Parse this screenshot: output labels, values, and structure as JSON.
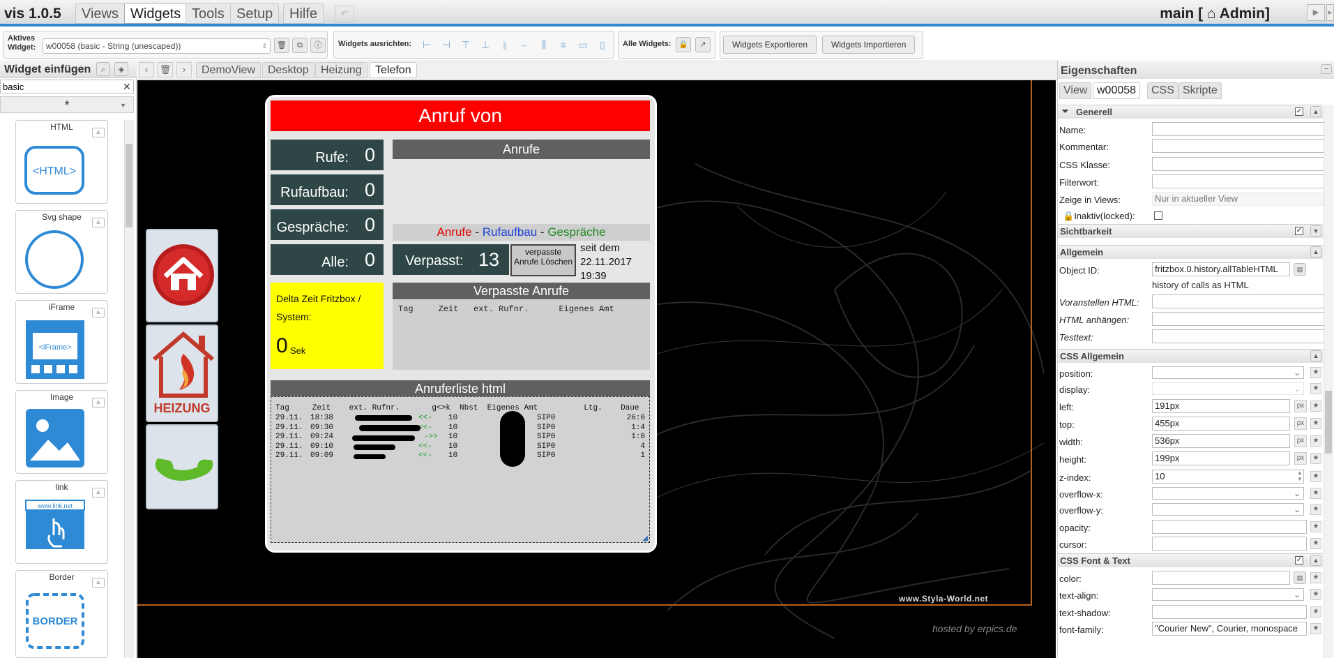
{
  "app": {
    "title": "vis 1.0.5",
    "menu": [
      "Views",
      "Widgets",
      "Tools",
      "Setup",
      "Hilfe"
    ],
    "active_menu": "Widgets",
    "main_title": "main [ ⌂ Admin]"
  },
  "toolbar": {
    "active_widget_label": "Aktives Widget:",
    "active_widget_value": "w00058 (basic - String (unescaped))",
    "align_label": "Widgets ausrichten:",
    "all_widgets_label": "Alle Widgets:",
    "export_label": "Widgets Exportieren",
    "import_label": "Widgets Importieren"
  },
  "left_panel": {
    "title": "Widget einfügen",
    "filter_value": "basic",
    "set_value": "*",
    "widgets": [
      "HTML",
      "Svg shape",
      "iFrame",
      "Image",
      "link",
      "Border"
    ]
  },
  "views": {
    "tabs": [
      "DemoView",
      "Desktop",
      "Heizung",
      "Telefon"
    ],
    "active": "Telefon"
  },
  "canvas": {
    "watermark": "www.Styla-World.net",
    "hosted": "hosted by erpics.de"
  },
  "phone": {
    "header": "Anruf von",
    "stats": [
      {
        "label": "Rufe:",
        "value": "0"
      },
      {
        "label": "Rufaufbau:",
        "value": "0"
      },
      {
        "label": "Gespräche:",
        "value": "0"
      },
      {
        "label": "Alle:",
        "value": "0"
      }
    ],
    "anrufe_header": "Anrufe",
    "legend": {
      "a": "Anrufe",
      "b": "Rufaufbau",
      "c": "Gespräche",
      "sep": "-"
    },
    "missed_label": "Verpasst:",
    "missed_value": "13",
    "delete_button": "verpasste Anrufe Löschen",
    "since_label": "seit dem",
    "since_date": "22.11.2017",
    "since_time": "19:39",
    "delta_label": "Delta Zeit Fritzbox / System:",
    "delta_value": "0",
    "delta_unit": "Sek",
    "missed_header": "Verpasste Anrufe",
    "missed_columns": "Tag     Zeit   ext. Rufnr.      Eigenes Amt",
    "list_header": "Anruferliste html",
    "list_columns": "Tag     Zeit    ext. Rufnr.       g<>k  Nbst  Eigenes Amt          Ltg.    Daue",
    "rows": [
      {
        "tag": "29.11.",
        "zeit": "18:38",
        "dir": "<<-",
        "nbst": "10",
        "ltg": "SIP0",
        "dauer": "26:0"
      },
      {
        "tag": "29.11.",
        "zeit": "09:30",
        "dir": "<<-",
        "nbst": "10",
        "ltg": "SIP0",
        "dauer": "1:4"
      },
      {
        "tag": "29.11.",
        "zeit": "09:24",
        "dir": "->>",
        "nbst": "10",
        "ltg": "SIP0",
        "dauer": "1:0"
      },
      {
        "tag": "29.11.",
        "zeit": "09:10",
        "dir": "<<-",
        "nbst": "10",
        "ltg": "SIP0",
        "dauer": "4"
      },
      {
        "tag": "29.11.",
        "zeit": "09:09",
        "dir": "<<-",
        "nbst": "10",
        "ltg": "SIP0",
        "dauer": "1"
      }
    ],
    "heizung_label": "HEIZUNG"
  },
  "right_panel": {
    "title": "Eigenschaften",
    "tabs": [
      "View",
      "w00058",
      "CSS",
      "Skripte"
    ],
    "active_tab": "w00058",
    "sections": {
      "generell": "Generell",
      "sichtbarkeit": "Sichtbarkeit",
      "allgemein": "Allgemein",
      "css_allgemein": "CSS Allgemein",
      "css_font": "CSS Font & Text"
    },
    "generell": {
      "name": "Name:",
      "kommentar": "Kommentar:",
      "css_klasse": "CSS Klasse:",
      "filterwort": "Filterwort:",
      "zeige": "Zeige in Views:",
      "zeige_value": "Nur in aktueller View",
      "inaktiv": "Inaktiv(locked):"
    },
    "allgemein": {
      "object_id": "Object ID:",
      "object_id_value": "fritzbox.0.history.allTableHTML",
      "object_desc": "history of calls as HTML",
      "voranstellen": "Voranstellen HTML:",
      "anhaengen": "HTML anhängen:",
      "testtext": "Testtext:"
    },
    "css": {
      "position": "position:",
      "display": "display:",
      "left": "left:",
      "left_value": "191px",
      "top": "top:",
      "top_value": "455px",
      "width": "width:",
      "width_value": "536px",
      "height": "height:",
      "height_value": "199px",
      "zindex": "z-index:",
      "zindex_value": "10",
      "overflowx": "overflow-x:",
      "overflowy": "overflow-y:",
      "opacity": "opacity:",
      "cursor": "cursor:",
      "unit": "px"
    },
    "font": {
      "color": "color:",
      "textalign": "text-align:",
      "textshadow": "text-shadow:",
      "fontfamily": "font-family:",
      "fontfamily_value": "\"Courier New\", Courier, monospace"
    }
  }
}
